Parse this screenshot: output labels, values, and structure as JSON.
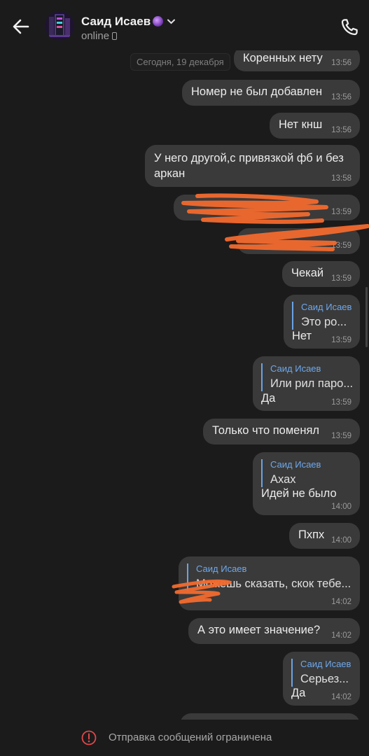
{
  "header": {
    "contact_name": "Саид Исаев",
    "status": "online",
    "accent_color": "#6ea8ec"
  },
  "chat": {
    "date_label": "Сегодня, 19 декабря",
    "messages": [
      {
        "text": "Коренных нету",
        "time": "13:56"
      },
      {
        "text": "Номер не был добавлен",
        "time": "13:56"
      },
      {
        "text": "Нет кнш",
        "time": "13:56"
      },
      {
        "text": "У него другой,с привязкой фб и без",
        "text2": "аркан",
        "time": "13:58"
      },
      {
        "text": "",
        "time": "13:59",
        "redacted": true
      },
      {
        "text": "",
        "time": "13:59",
        "redacted": true
      },
      {
        "text": "Чекай",
        "time": "13:59"
      },
      {
        "reply_author": "Саид Исаев",
        "reply_text": "Это ро...",
        "text": "Нет",
        "time": "13:59"
      },
      {
        "reply_author": "Саид Исаев",
        "reply_text": "Или рил паро...",
        "text": "Да",
        "time": "13:59"
      },
      {
        "text": "Только что поменял",
        "time": "13:59"
      },
      {
        "reply_author": "Саид Исаев",
        "reply_text": "Ахах",
        "text": "Идей не было",
        "time": "14:00"
      },
      {
        "text": "Пхпх",
        "time": "14:00"
      },
      {
        "reply_author": "Саид Исаев",
        "reply_text": "Можешь сказать, скок тебе...",
        "text": "",
        "time": "14:02"
      },
      {
        "text": "А это имеет значение?",
        "time": "14:02"
      },
      {
        "reply_author": "Саид Исаев",
        "reply_text": "Серьез...",
        "text": "Да",
        "time": "14:02"
      }
    ]
  },
  "footer": {
    "restricted_text": "Отправка сообщений ограничена",
    "warning_color": "#e0484a"
  }
}
